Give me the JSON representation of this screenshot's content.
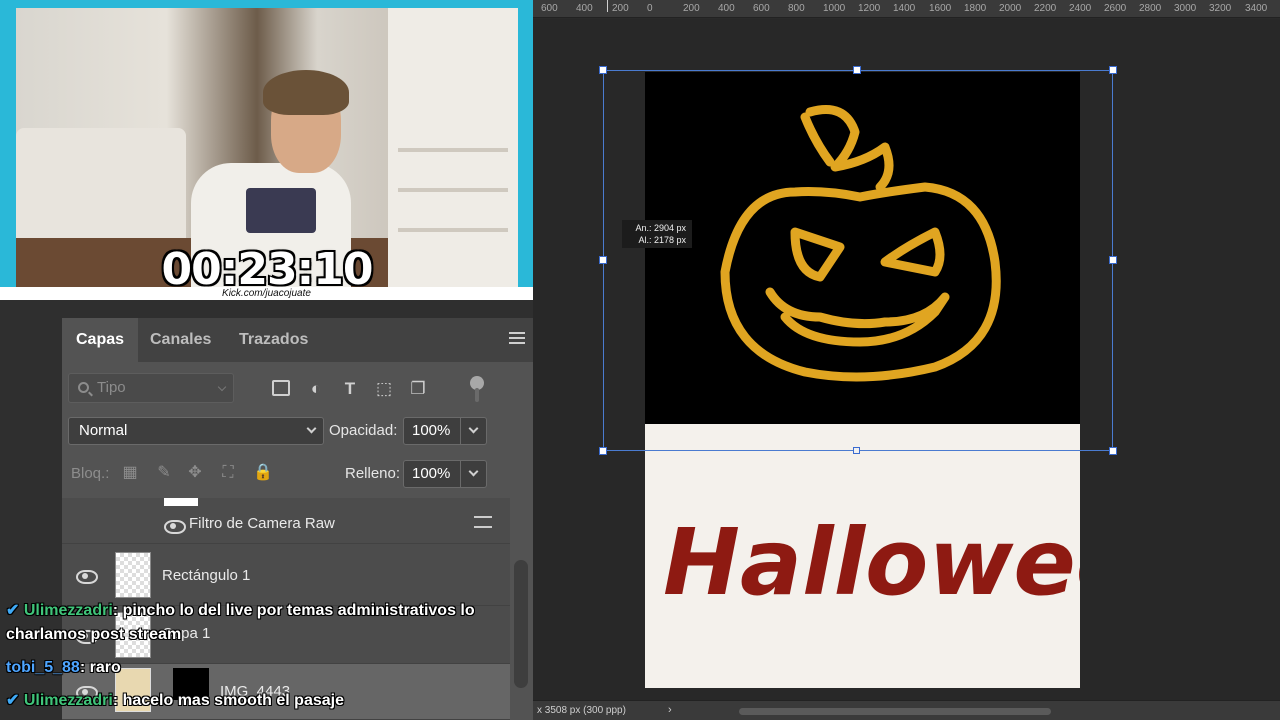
{
  "webcam": {
    "timer": "00:23:10",
    "kick_url": "Kick.com/juacojuate"
  },
  "panel": {
    "tabs": [
      "Capas",
      "Canales",
      "Trazados"
    ],
    "search_placeholder": "Tipo",
    "blend_mode": "Normal",
    "opacity_label": "Opacidad:",
    "opacity_value": "100%",
    "lock_label": "Bloq.:",
    "fill_label": "Relleno:",
    "fill_value": "100%"
  },
  "layers": [
    {
      "name": "Filtro de Camera Raw"
    },
    {
      "name": "Rectángulo 1"
    },
    {
      "name": "Capa 1"
    },
    {
      "name": "IMG_4443"
    }
  ],
  "chat": [
    {
      "user": "Ulimezzadri",
      "message": "pincho lo del live por temas administrativos lo charlamos post stream"
    },
    {
      "user": "tobi_5_88",
      "message": "raro"
    },
    {
      "user": "Ulimezzadri",
      "message": "hacelo mas smooth el pasaje"
    }
  ],
  "ruler_ticks": [
    "600",
    "400",
    "200",
    "0",
    "200",
    "400",
    "600",
    "800",
    "1000",
    "1200",
    "1400",
    "1600",
    "1800",
    "2000",
    "2200",
    "2400",
    "2600",
    "2800",
    "3000",
    "3200",
    "3400"
  ],
  "transform_tooltip": {
    "width": "An.: 2904 px",
    "height": "Al.: 2178 px"
  },
  "status_bar": {
    "doc_info": "x 3508 px (300 ppp)"
  },
  "canvas": {
    "halloween_text": "Halloween"
  },
  "colors": {
    "accent_webcam": "#2ab8d8",
    "selection": "#4a7bd0",
    "pumpkin": "#e0a521",
    "ketchup": "#8e1a12"
  }
}
